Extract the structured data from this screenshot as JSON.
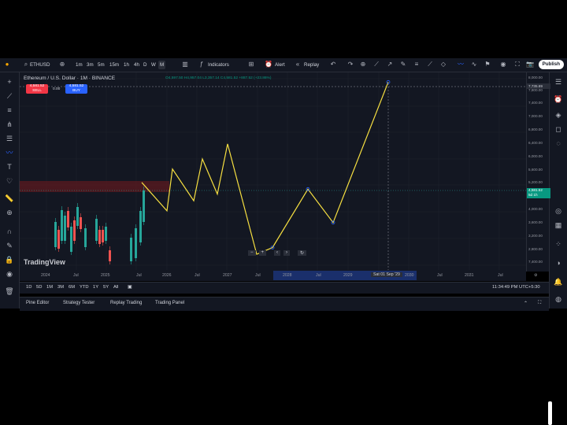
{
  "toolbar": {
    "symbol": "ETHUSD",
    "intervals": [
      "1m",
      "3m",
      "5m",
      "15m",
      "1h",
      "4h",
      "D",
      "W",
      "M"
    ],
    "active_interval": "M",
    "indicators_label": "Indicators",
    "alert_label": "Alert",
    "replay_label": "Replay",
    "publish_label": "Publish"
  },
  "legend": {
    "title": "Ethereum / U.S. Dollar · 1M · BINANCE",
    "ohlc": "O4,597.50 H4,957.04 L3,357.14 C4,581.52 +887.52 (+23.86%)",
    "sell_price": "4,581.52",
    "sell_label": "SELL",
    "spread": "0.00",
    "buy_price": "4,581.52",
    "buy_label": "BUY"
  },
  "price_scale": {
    "labels": [
      "8,000.00",
      "7,800.00",
      "7,400.00",
      "7,000.00",
      "6,800.00",
      "6,400.00",
      "6,000.00",
      "5,600.00",
      "5,200.00",
      "4,800.00",
      "4,000.00",
      "3,600.00",
      "3,200.00",
      "2,800.00",
      "7,400.00"
    ],
    "top_marker": "7,735.69",
    "current_price": "4,581.52",
    "countdown": "5d 1h"
  },
  "time_axis": {
    "labels": [
      "2024",
      "Jul",
      "2025",
      "Jul",
      "2026",
      "Jul",
      "2027",
      "Jul",
      "2028",
      "Jul",
      "2029",
      "Jul",
      "2030",
      "Jul",
      "2031",
      "Jul"
    ],
    "cursor_label": "Sat 01 Sep '29"
  },
  "range_bar": {
    "ranges": [
      "1D",
      "5D",
      "1M",
      "3M",
      "6M",
      "YTD",
      "1Y",
      "5Y",
      "All"
    ],
    "clock": "11:34:49 PM UTC+5:30"
  },
  "bottom_tabs": [
    "Pine Editor",
    "Strategy Tester",
    "Replay Trading",
    "Trading Panel"
  ],
  "logo_text": "TradingView",
  "colors": {
    "background": "#131722",
    "up": "#26a69a",
    "down": "#ef5350",
    "projection_line": "#f7e041",
    "accent": "#2962ff"
  },
  "chart_data": {
    "type": "candlestick",
    "candles_direction": [
      "up",
      "down",
      "up",
      "up",
      "down",
      "up",
      "down",
      "up",
      "down",
      "up",
      "up",
      "down",
      "down",
      "up",
      "down",
      "up",
      "up",
      "up",
      "up"
    ],
    "projection_path_prices": [
      4900,
      4050,
      5300,
      4350,
      5600,
      4550,
      6050,
      2750,
      2950,
      4700,
      3700,
      7900
    ],
    "resistance_zone": [
      4500,
      4750
    ]
  }
}
